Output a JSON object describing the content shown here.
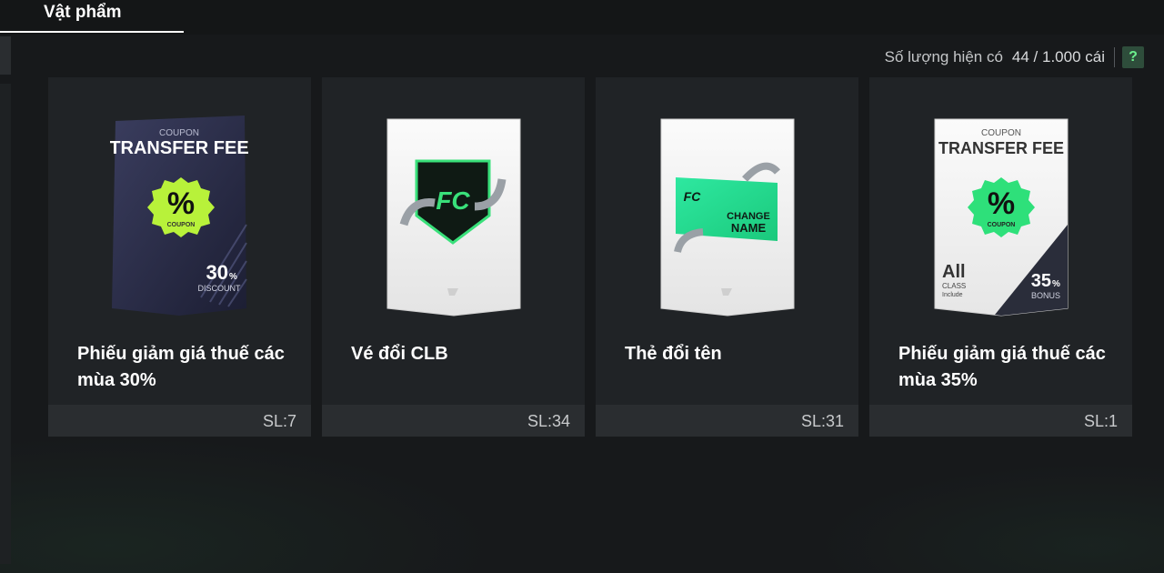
{
  "tabs": {
    "items_label": "Vật phẩm"
  },
  "capacity": {
    "label": "Số lượng hiện có",
    "value": "44 / 1.000 cái",
    "help_label": "?"
  },
  "items": [
    {
      "name": "Phiếu giảm giá thuế các mùa 30%",
      "quantity": "SL:7",
      "art": {
        "top": "COUPON",
        "title": "TRANSFER FEE",
        "badge": "%",
        "badge_sub": "COUPON",
        "value": "30",
        "value_unit": "%",
        "value_caption": "DISCOUNT"
      }
    },
    {
      "name": "Vé đổi CLB",
      "quantity": "SL:34",
      "art": {}
    },
    {
      "name": "Thẻ đổi tên",
      "quantity": "SL:31",
      "art": {
        "change": "CHANGE",
        "name": "NAME"
      }
    },
    {
      "name": "Phiếu giảm giá thuế các mùa 35%",
      "quantity": "SL:1",
      "art": {
        "top": "COUPON",
        "title": "TRANSFER FEE",
        "badge": "%",
        "badge_sub": "COUPON",
        "class_all": "All",
        "class_label": "CLASS",
        "class_include": "Include",
        "value": "35",
        "value_unit": "%",
        "value_caption": "BONUS"
      }
    }
  ],
  "colors": {
    "accent_green": "#39e07a",
    "badge_lime": "#b8f23a",
    "card_bg": "#202326"
  }
}
